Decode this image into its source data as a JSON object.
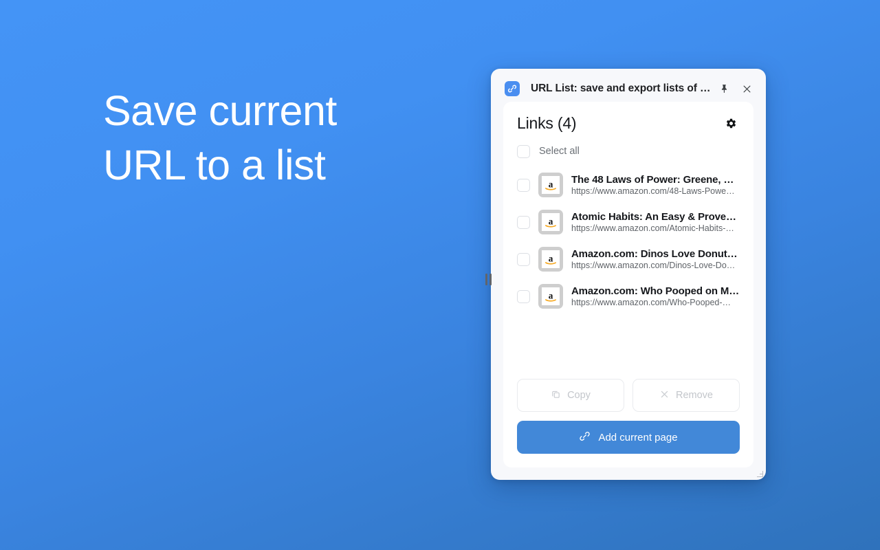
{
  "page": {
    "headline": "Save current\nURL to a list",
    "background_top_color": "#4494f6",
    "background_bottom_color": "#2f72bb"
  },
  "popup": {
    "titlebar": {
      "extension_icon": "link-icon",
      "title": "URL List: save and export lists of UR…",
      "pin_icon": "pin-icon",
      "close_icon": "close-icon"
    },
    "header": {
      "title": "Links (4)",
      "settings_icon": "gear-icon"
    },
    "select_all": {
      "label": "Select all",
      "checked": false
    },
    "links": [
      {
        "title": "The 48 Laws of Power: Greene, R…",
        "url": "https://www.amazon.com/48-Laws-Powe…",
        "favicon": "amazon-favicon",
        "checked": false
      },
      {
        "title": "Atomic Habits: An Easy & Proven…",
        "url": "https://www.amazon.com/Atomic-Habits-…",
        "favicon": "amazon-favicon",
        "checked": false
      },
      {
        "title": "Amazon.com: Dinos Love Donuts…",
        "url": "https://www.amazon.com/Dinos-Love-Do…",
        "favicon": "amazon-favicon",
        "checked": false
      },
      {
        "title": "Amazon.com: Who Pooped on M…",
        "url": "https://www.amazon.com/Who-Pooped-…",
        "favicon": "amazon-favicon",
        "checked": false
      }
    ],
    "actions": {
      "copy_label": "Copy",
      "copy_icon": "copy-icon",
      "remove_label": "Remove",
      "remove_icon": "close-x-icon",
      "add_label": "Add current page",
      "add_icon": "link-icon",
      "primary_color": "#4288d8",
      "disabled_color": "#c3c6cb"
    }
  }
}
